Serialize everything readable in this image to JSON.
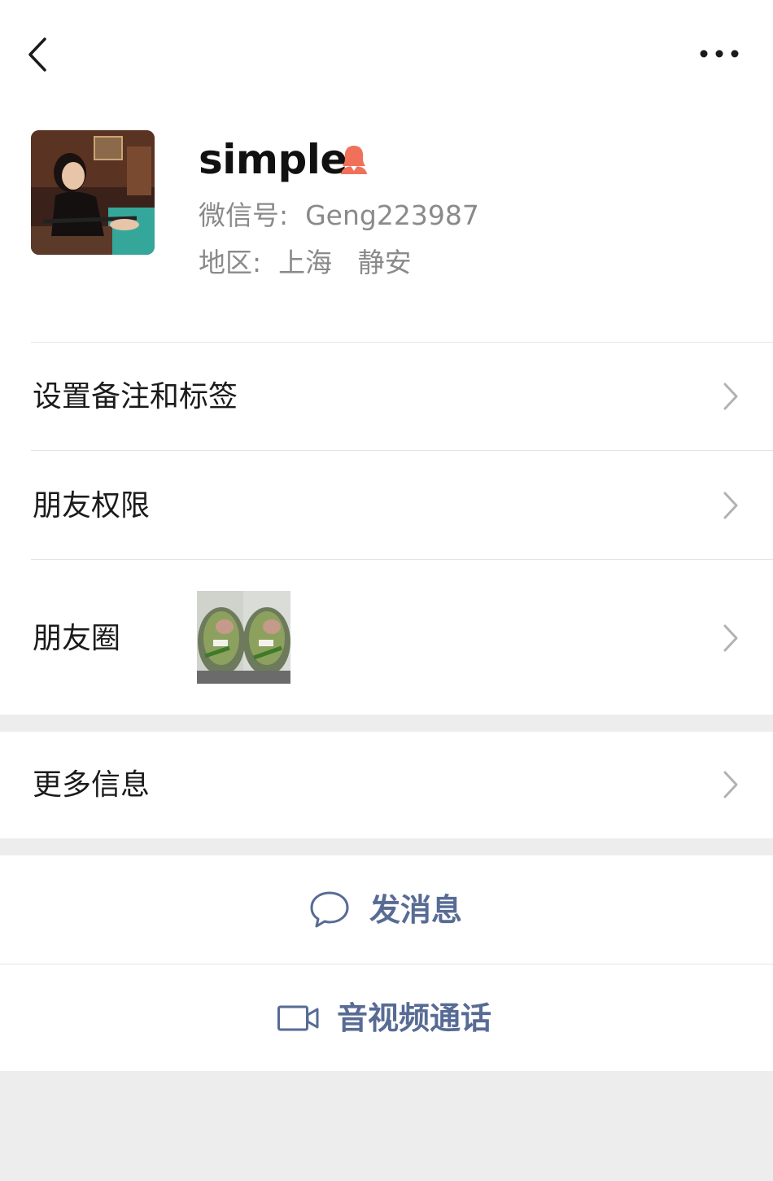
{
  "nav": {
    "back_icon": "chevron-left-icon",
    "more_icon": "more-dots-icon"
  },
  "profile": {
    "name": "simple",
    "gender_icon": "female-icon",
    "gender_color": "#f0705a",
    "wechat_id": "微信号:  Geng223987",
    "region": "地区:  上海   静安"
  },
  "menu": {
    "remark_label": "设置备注和标签",
    "permission_label": "朋友权限",
    "moments_label": "朋友圈",
    "more_info_label": "更多信息"
  },
  "actions": {
    "message_label": "发消息",
    "video_call_label": "音视频通话",
    "accent_color": "#576b95"
  }
}
